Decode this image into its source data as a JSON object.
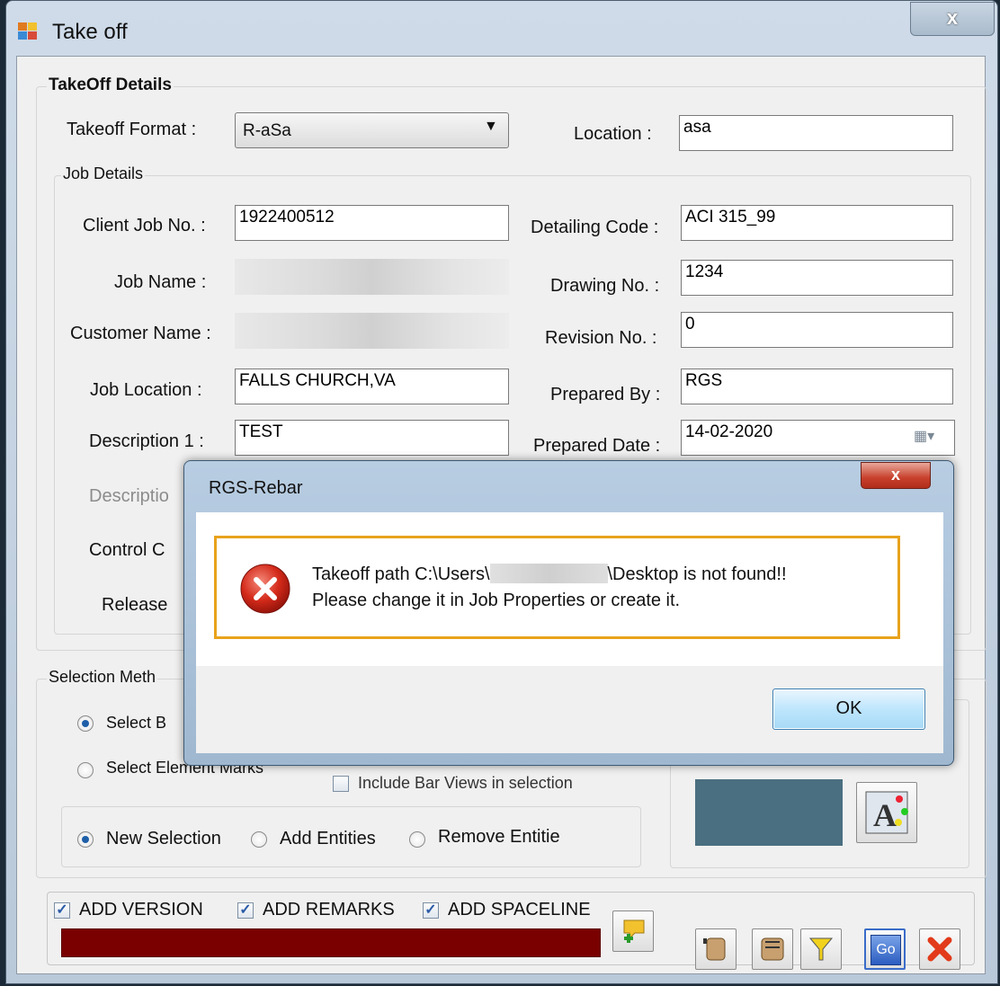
{
  "window": {
    "title": "Take off",
    "close": "x"
  },
  "takeoff_details": {
    "group_label": "TakeOff Details",
    "format_label": "Takeoff Format :",
    "format_value": "R-aSa",
    "location_label": "Location :",
    "location_value": "asa"
  },
  "job_details": {
    "group_label": "Job Details",
    "client_job_no_label": "Client Job No. :",
    "client_job_no": "1922400512",
    "detailing_code_label": "Detailing Code :",
    "detailing_code": "ACI 315_99",
    "job_name_label": "Job Name :",
    "drawing_no_label": "Drawing No. :",
    "drawing_no": "1234",
    "customer_name_label": "Customer Name :",
    "revision_no_label": "Revision No. :",
    "revision_no": "0",
    "job_location_label": "Job Location :",
    "job_location": "FALLS CHURCH,VA",
    "prepared_by_label": "Prepared By :",
    "prepared_by": "RGS",
    "description1_label": "Description 1 :",
    "description1": "TEST",
    "prepared_date_label": "Prepared Date :",
    "prepared_date": "14-02-2020",
    "description2_label": "Descriptio",
    "control_label": "Control C",
    "release_label": "Release"
  },
  "selection": {
    "group_label": "Selection Meth",
    "select_bar_label": "Select B",
    "select_element_label": "Select Element Marks",
    "include_bar_views": "Include Bar Views  in selection",
    "new_selection": "New Selection",
    "add_entities": "Add Entities",
    "remove_entities": "Remove Entitie"
  },
  "bottom": {
    "add_version": "ADD VERSION",
    "add_remarks": "ADD REMARKS",
    "add_spaceline": "ADD SPACELINE",
    "go_label": "Go"
  },
  "dialog": {
    "title": "RGS-Rebar",
    "message_part1": "Takeoff path C:\\Users\\",
    "message_part2": "\\Desktop is not found!!",
    "message_line2": "Please change it in Job Properties or create it.",
    "ok_label": "OK",
    "close": "x"
  },
  "colors": {
    "progress_bar": "#7a0000",
    "preview_swatch": "#4a6f80",
    "highlight": "#e8a21c"
  }
}
